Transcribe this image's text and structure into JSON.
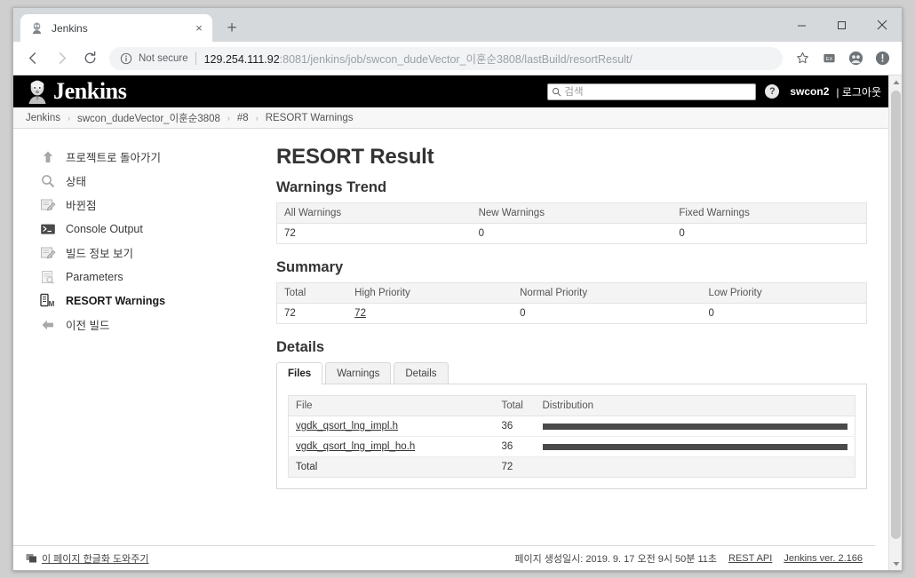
{
  "browser": {
    "tab": {
      "title": "Jenkins",
      "favicon": "jenkins-favicon",
      "close": "×"
    },
    "new_tab": "+",
    "window_controls": {
      "minimize": "–",
      "maximize": "□",
      "close": "✕"
    },
    "nav": {
      "back": "←",
      "forward": "→",
      "reload": "↻"
    },
    "omnibox": {
      "security_label": "Not secure",
      "url_host": "129.254.111.92",
      "url_path": ":8081/jenkins/job/swcon_dudeVector_이훈순3808/lastBuild/resortResult/",
      "full_url": "129.254.111.92:8081/jenkins/job/swcon_dudeVector_이훈순3808/lastBuild/resortResult/"
    },
    "toolbar_icons": [
      "star-icon",
      "extension-icon",
      "profile-avatar-icon",
      "alert-icon"
    ]
  },
  "jenkins_header": {
    "logo_text": "Jenkins",
    "search_placeholder": "검색",
    "help_label": "?",
    "user": "swcon2",
    "logout": "| 로그아웃"
  },
  "breadcrumb": {
    "items": [
      "Jenkins",
      "swcon_dudeVector_이훈순3808",
      "#8",
      "RESORT Warnings"
    ],
    "separator": "›"
  },
  "sidebar": {
    "items": [
      {
        "label": "프로젝트로 돌아가기",
        "icon": "up-arrow-icon",
        "bold": false
      },
      {
        "label": "상태",
        "icon": "magnifier-icon",
        "bold": false
      },
      {
        "label": "바뀐점",
        "icon": "edit-document-icon",
        "bold": false
      },
      {
        "label": "Console Output",
        "icon": "terminal-icon",
        "bold": false
      },
      {
        "label": "빌드 정보 보기",
        "icon": "edit-document-icon",
        "bold": false
      },
      {
        "label": "Parameters",
        "icon": "parameters-icon",
        "bold": false
      },
      {
        "label": "RESORT Warnings",
        "icon": "warnings-meter-icon",
        "bold": true
      },
      {
        "label": "이전 빌드",
        "icon": "left-arrow-icon",
        "bold": false
      }
    ]
  },
  "main": {
    "page_title": "RESORT Result",
    "warnings_trend": {
      "heading": "Warnings Trend",
      "columns": [
        "All Warnings",
        "New Warnings",
        "Fixed Warnings"
      ],
      "row": [
        "72",
        "0",
        "0"
      ]
    },
    "summary": {
      "heading": "Summary",
      "columns": [
        "Total",
        "High Priority",
        "Normal Priority",
        "Low Priority"
      ],
      "row": [
        "72",
        "72",
        "0",
        "0"
      ],
      "high_priority_is_link": true
    },
    "details": {
      "heading": "Details",
      "tabs": [
        {
          "label": "Files",
          "active": true
        },
        {
          "label": "Warnings",
          "active": false
        },
        {
          "label": "Details",
          "active": false
        }
      ],
      "files_table": {
        "columns": [
          "File",
          "Total",
          "Distribution"
        ],
        "rows": [
          {
            "file": "vgdk_qsort_lng_impl.h",
            "total": "36",
            "distribution_pct": 100
          },
          {
            "file": "vgdk_qsort_lng_impl_ho.h",
            "total": "36",
            "distribution_pct": 100
          }
        ],
        "total_row": {
          "label": "Total",
          "total": "72"
        }
      }
    }
  },
  "footer": {
    "translate_link": "이 페이지 한글화 도와주기",
    "generated": "페이지 생성일시: 2019. 9. 17 오전 9시 50분 11초",
    "rest_api": "REST API",
    "version": "Jenkins ver. 2.166"
  },
  "colors": {
    "header_bg": "#000000",
    "dist_bar": "#4a4a4a",
    "table_header_bg": "#f4f4f4",
    "accent_link": "#333333"
  }
}
